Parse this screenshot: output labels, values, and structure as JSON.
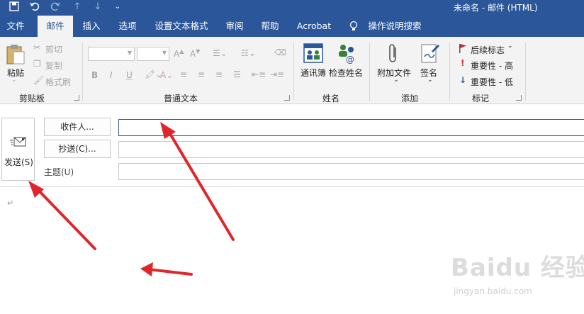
{
  "window": {
    "title": "未命名 - 邮件 (HTML)"
  },
  "tabs": [
    "文件",
    "邮件",
    "插入",
    "选项",
    "设置文本格式",
    "审阅",
    "帮助",
    "Acrobat"
  ],
  "tell_me": "操作说明搜索",
  "ribbon": {
    "clipboard": {
      "paste": "粘贴",
      "cut": "剪切",
      "copy": "复制",
      "format_painter": "格式刷",
      "label": "剪贴板"
    },
    "basic_text": {
      "bold": "B",
      "italic": "I",
      "underline": "U",
      "label": "普通文本"
    },
    "names": {
      "address_book": "通讯簿",
      "check_names": "检查姓名",
      "label": "姓名"
    },
    "include": {
      "attach_file": "附加文件",
      "signature": "签名",
      "label": "添加"
    },
    "tags": {
      "follow_up": "后续标志",
      "high_importance": "重要性 - 高",
      "low_importance": "重要性 - 低",
      "label": "标记"
    }
  },
  "compose": {
    "send": "发送(S)",
    "to": "收件人...",
    "cc": "抄送(C)...",
    "subject": "主题(U)",
    "to_value": "",
    "cc_value": "",
    "subject_value": ""
  },
  "watermark": {
    "brand": "Baidu 经验",
    "url": "jingyan.baidu.com"
  },
  "colors": {
    "accent": "#2b579a",
    "annotation_arrow": "#e0262b"
  }
}
